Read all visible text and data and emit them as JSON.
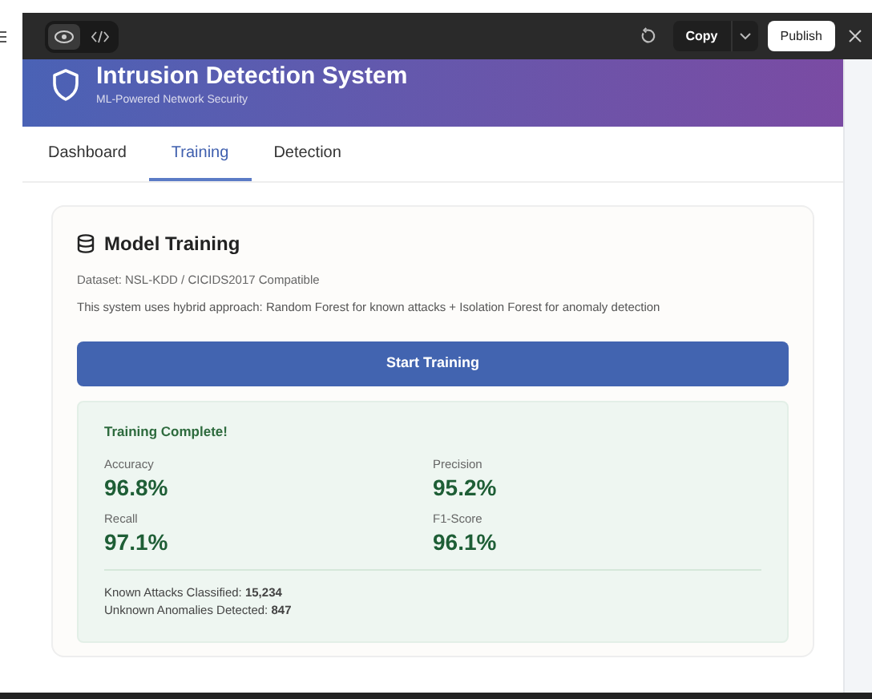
{
  "toolbar": {
    "copy_label": "Copy",
    "publish_label": "Publish"
  },
  "header": {
    "title": "Intrusion Detection System",
    "subtitle": "ML-Powered Network Security"
  },
  "tabs": [
    {
      "label": "Dashboard",
      "selected": false
    },
    {
      "label": "Training",
      "selected": true
    },
    {
      "label": "Detection",
      "selected": false
    }
  ],
  "card": {
    "title": "Model Training",
    "dataset": "Dataset: NSL-KDD / CICIDS2017 Compatible",
    "description": "This system uses hybrid approach: Random Forest for known attacks + Isolation Forest for anomaly detection",
    "button": "Start Training",
    "result": {
      "title": "Training Complete!",
      "metrics": [
        {
          "label": "Accuracy",
          "value": "96.8%"
        },
        {
          "label": "Precision",
          "value": "95.2%"
        },
        {
          "label": "Recall",
          "value": "97.1%"
        },
        {
          "label": "F1-Score",
          "value": "96.1%"
        }
      ],
      "stats": [
        "Known Attacks Classified: **15,234**",
        "Unknown Anomalies Detected: **847**"
      ]
    }
  }
}
